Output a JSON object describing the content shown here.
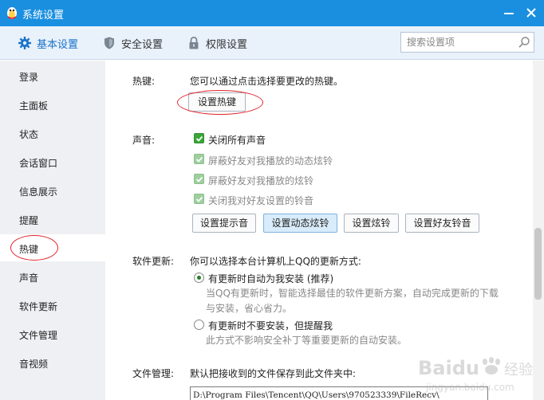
{
  "window": {
    "title": "系统设置"
  },
  "tabs": [
    {
      "label": "基本设置",
      "icon": "gear-icon",
      "active": true
    },
    {
      "label": "安全设置",
      "icon": "shield-icon",
      "active": false
    },
    {
      "label": "权限设置",
      "icon": "lock-icon",
      "active": false
    }
  ],
  "search": {
    "placeholder": "搜索设置项"
  },
  "sidebar": {
    "items": [
      {
        "label": "登录"
      },
      {
        "label": "主面板"
      },
      {
        "label": "状态"
      },
      {
        "label": "会话窗口"
      },
      {
        "label": "信息展示"
      },
      {
        "label": "提醒"
      },
      {
        "label": "热键",
        "active": true
      },
      {
        "label": "声音"
      },
      {
        "label": "软件更新"
      },
      {
        "label": "文件管理"
      },
      {
        "label": "音视频"
      }
    ]
  },
  "hotkey": {
    "label": "热键:",
    "description": "您可以通过点击选择要更改的热键。",
    "button": "设置热键"
  },
  "sound": {
    "label": "声音:",
    "checkboxes": [
      {
        "label": "关闭所有声音",
        "checked": true,
        "enabled": true
      },
      {
        "label": "屏蔽好友对我播放的动态炫铃",
        "checked": true,
        "enabled": false
      },
      {
        "label": "屏蔽好友对我播放的炫铃",
        "checked": true,
        "enabled": false
      },
      {
        "label": "关闭我对好友设置的铃音",
        "checked": true,
        "enabled": false
      }
    ],
    "buttons": [
      "设置提示音",
      "设置动态炫铃",
      "设置炫铃",
      "设置好友铃音"
    ]
  },
  "update": {
    "label": "软件更新:",
    "description": "你可以选择本台计算机上QQ的更新方式:",
    "options": [
      {
        "label": "有更新时自动为我安装 (推荐)",
        "selected": true,
        "desc1": "当QQ有更新时，智能选择最佳的软件更新方案，自动完成更新的下载",
        "desc2": "与安装，省心省力。"
      },
      {
        "label": "有更新时不要安装，但提醒我",
        "selected": false,
        "desc1": "此方式不影响安全补丁等重要更新的自动安装。"
      }
    ]
  },
  "files": {
    "label": "文件管理:",
    "description": "默认把接收到的文件保存到此文件夹中:",
    "path": "D:\\Program Files\\Tencent\\QQ\\Users\\970523339\\FileRecv\\"
  },
  "watermark": {
    "text": "Baidu经验",
    "url": "jingyan.baidu.com"
  },
  "colors": {
    "titlebar": "#1a8fe0",
    "accent": "#1a74c9",
    "check_green": "#3aa63a",
    "annotation_red": "#e0242b"
  }
}
